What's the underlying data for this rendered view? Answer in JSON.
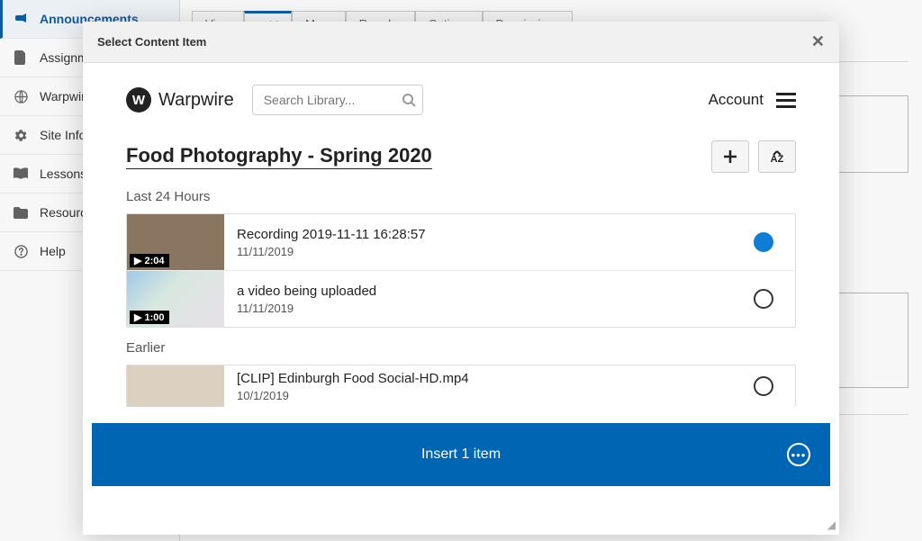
{
  "sidebar": {
    "items": [
      {
        "label": "Announcements",
        "icon": "bullhorn"
      },
      {
        "label": "Assignments",
        "icon": "file"
      },
      {
        "label": "Warpwire",
        "icon": "globe"
      },
      {
        "label": "Site Info",
        "icon": "gear"
      },
      {
        "label": "Lessons",
        "icon": "book"
      },
      {
        "label": "Resources",
        "icon": "folder"
      },
      {
        "label": "Help",
        "icon": "question"
      }
    ]
  },
  "bg_tabs": [
    "View",
    "Add",
    "More",
    "Reorder",
    "Options",
    "Permissions"
  ],
  "modal": {
    "title": "Select Content Item",
    "brand": "Warpwire",
    "search_placeholder": "Search Library...",
    "account_label": "Account",
    "library_title": "Food Photography - Spring 2020",
    "sort_label": "AZ",
    "sections": [
      {
        "label": "Last 24 Hours",
        "items": [
          {
            "title": "Recording 2019-11-11 16:28:57",
            "date": "11/11/2019",
            "duration": "2:04",
            "selected": true,
            "thumb": "t1"
          },
          {
            "title": "a video being uploaded",
            "date": "11/11/2019",
            "duration": "1:00",
            "selected": false,
            "thumb": "t2"
          }
        ]
      },
      {
        "label": "Earlier",
        "items": [
          {
            "title": "[CLIP] Edinburgh Food Social-HD.mp4",
            "date": "10/1/2019",
            "duration": "",
            "selected": false,
            "thumb": "t3"
          }
        ]
      }
    ],
    "insert_label": "Insert 1 item"
  }
}
